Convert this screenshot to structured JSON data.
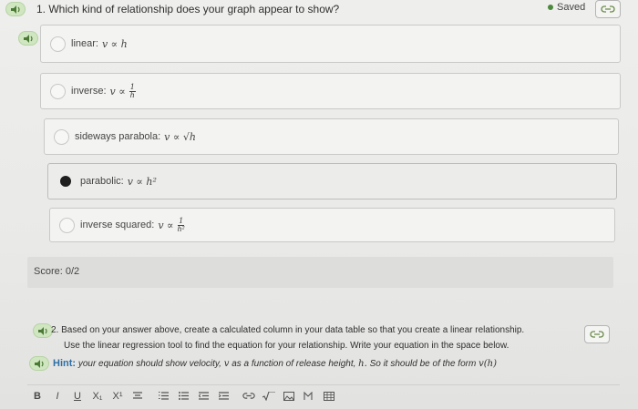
{
  "header": {
    "question_number": "1.",
    "question_text": "Which kind of relationship does your graph appear to show?",
    "saved_label": "Saved"
  },
  "choices": [
    {
      "label": "linear:",
      "expr": "v ∝ h",
      "selected": false
    },
    {
      "label": "inverse:",
      "expr": "v ∝",
      "frac_num": "1",
      "frac_den": "h",
      "selected": false
    },
    {
      "label": "sideways parabola:",
      "expr": "v ∝ √h",
      "selected": false
    },
    {
      "label": "parabolic:",
      "expr": "v ∝ h²",
      "selected": true
    },
    {
      "label": "inverse squared:",
      "expr": "v ∝",
      "frac_num": "1",
      "frac_den": "h²",
      "selected": false
    }
  ],
  "score": {
    "label": "Score:",
    "value": "0/2"
  },
  "question2": {
    "number": "2.",
    "line1": "Based on your answer above, create a calculated column in your data table so that you create a linear relationship.",
    "line2": "Use the linear regression tool to find the equation for your relationship. Write your equation in the space below.",
    "hint_label": "Hint:",
    "hint_text": "your equation should show velocity,",
    "hint_v": "v",
    "hint_mid": "as a function of release height,",
    "hint_h": "h.",
    "hint_end": "So it should be of the form",
    "hint_form": "v(h)"
  },
  "toolbar": {
    "bold": "B",
    "italic": "I",
    "underline": "U",
    "subscript": "X₁",
    "superscript": "X¹"
  },
  "icons": [
    "speaker-icon",
    "link-icon",
    "radio-icon",
    "align-icon",
    "list-icon",
    "indent-icon",
    "sqrt-icon",
    "image-icon",
    "table-icon"
  ],
  "colors": {
    "accent_green": "#4c7a36",
    "hint_blue": "#2e6fa6"
  }
}
